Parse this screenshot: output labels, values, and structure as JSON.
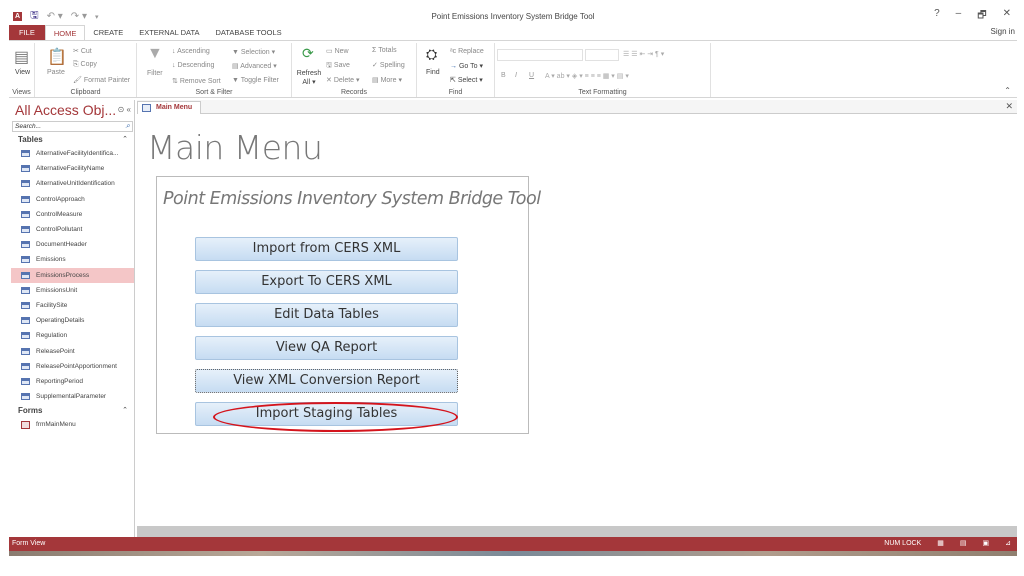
{
  "app": {
    "title": "Point Emissions Inventory System Bridge Tool",
    "sign_in": "Sign in",
    "logo": "A",
    "help": "?",
    "minimize": "–",
    "restore": "🗗",
    "close": "✕"
  },
  "ribbon_tabs": [
    "FILE",
    "HOME",
    "CREATE",
    "EXTERNAL DATA",
    "DATABASE TOOLS"
  ],
  "ribbon": {
    "views": {
      "label": "Views",
      "view": "View"
    },
    "clipboard": {
      "label": "Clipboard",
      "paste": "Paste",
      "cut": "Cut",
      "copy": "Copy",
      "format_painter": "Format Painter"
    },
    "sort_filter": {
      "label": "Sort & Filter",
      "filter": "Filter",
      "ascending": "Ascending",
      "descending": "Descending",
      "remove_sort": "Remove Sort",
      "selection": "Selection ▾",
      "advanced": "Advanced ▾",
      "toggle_filter": "Toggle Filter"
    },
    "records": {
      "label": "Records",
      "refresh": "Refresh All ▾",
      "new": "New",
      "save": "Save",
      "delete": "Delete ▾",
      "totals": "Totals",
      "spelling": "Spelling",
      "more": "More ▾"
    },
    "find": {
      "label": "Find",
      "find": "Find",
      "replace": "Replace",
      "goto": "Go To ▾",
      "select": "Select ▾"
    },
    "text_formatting": {
      "label": "Text Formatting",
      "bold": "B",
      "italic": "I",
      "underline": "U"
    }
  },
  "nav": {
    "title": "All Access Obj...",
    "search_placeholder": "Search...",
    "tables_header": "Tables",
    "tables": [
      "AlternativeFacilityIdentifica...",
      "AlternativeFacilityName",
      "AlternativeUnitIdentification",
      "ControlApproach",
      "ControlMeasure",
      "ControlPollutant",
      "DocumentHeader",
      "Emissions",
      "EmissionsProcess",
      "EmissionsUnit",
      "FacilitySite",
      "OperatingDetails",
      "Regulation",
      "ReleasePoint",
      "ReleasePointApportionment",
      "ReportingPeriod",
      "SupplementalParameter"
    ],
    "selected_table": "EmissionsProcess",
    "forms_header": "Forms",
    "forms": [
      "frmMainMenu"
    ]
  },
  "document": {
    "tab": "Main Menu",
    "heading": "Main Menu",
    "subtitle": "Point Emissions Inventory System Bridge Tool",
    "buttons": [
      "Import from CERS XML",
      "Export To CERS XML",
      "Edit Data Tables",
      "View QA Report",
      "View XML Conversion Report",
      "Import Staging Tables"
    ],
    "highlighted_button": "Import Staging Tables",
    "highlight_color": "#d4141c"
  },
  "status": {
    "left": "Form View",
    "num_lock": "NUM LOCK"
  },
  "colors": {
    "accent": "#a4373a",
    "button": "#c6dcf2",
    "selected_row": "#f4c6c7"
  }
}
